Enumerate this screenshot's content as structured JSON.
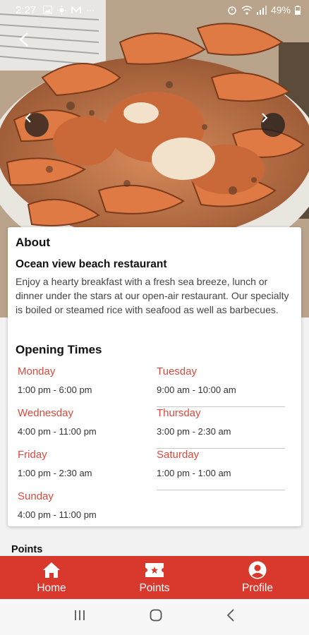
{
  "status_bar": {
    "time": "2:27",
    "more": "···",
    "battery": "49%"
  },
  "about": {
    "title": "About",
    "name": "Ocean view beach restaurant",
    "description": "Enjoy a hearty breakfast with a fresh sea breeze, lunch or dinner under the stars at our open-air restaurant. Our specialty is boiled or steamed rice with seafood as well as barbecues."
  },
  "opening_times": {
    "title": "Opening Times",
    "days": [
      {
        "day": "Monday",
        "hours": "1:00 pm - 6:00 pm"
      },
      {
        "day": "Tuesday",
        "hours": "9:00 am - 10:00 am"
      },
      {
        "day": "Wednesday",
        "hours": "4:00 pm - 11:00 pm"
      },
      {
        "day": "Thursday",
        "hours": "3:00 pm - 2:30 am"
      },
      {
        "day": "Friday",
        "hours": "1:00 pm - 2:30 am"
      },
      {
        "day": "Saturday",
        "hours": "1:00 pm - 1:00 am"
      },
      {
        "day": "Sunday",
        "hours": "4:00 pm - 11:00 pm"
      }
    ]
  },
  "points": {
    "label": "Points"
  },
  "bottom_nav": {
    "tabs": [
      {
        "label": "Home",
        "icon": "home-icon"
      },
      {
        "label": "Points",
        "icon": "ticket-icon"
      },
      {
        "label": "Profile",
        "icon": "account-icon"
      }
    ]
  },
  "colors": {
    "accent": "#d9382d",
    "day_text": "#d94a3f"
  }
}
